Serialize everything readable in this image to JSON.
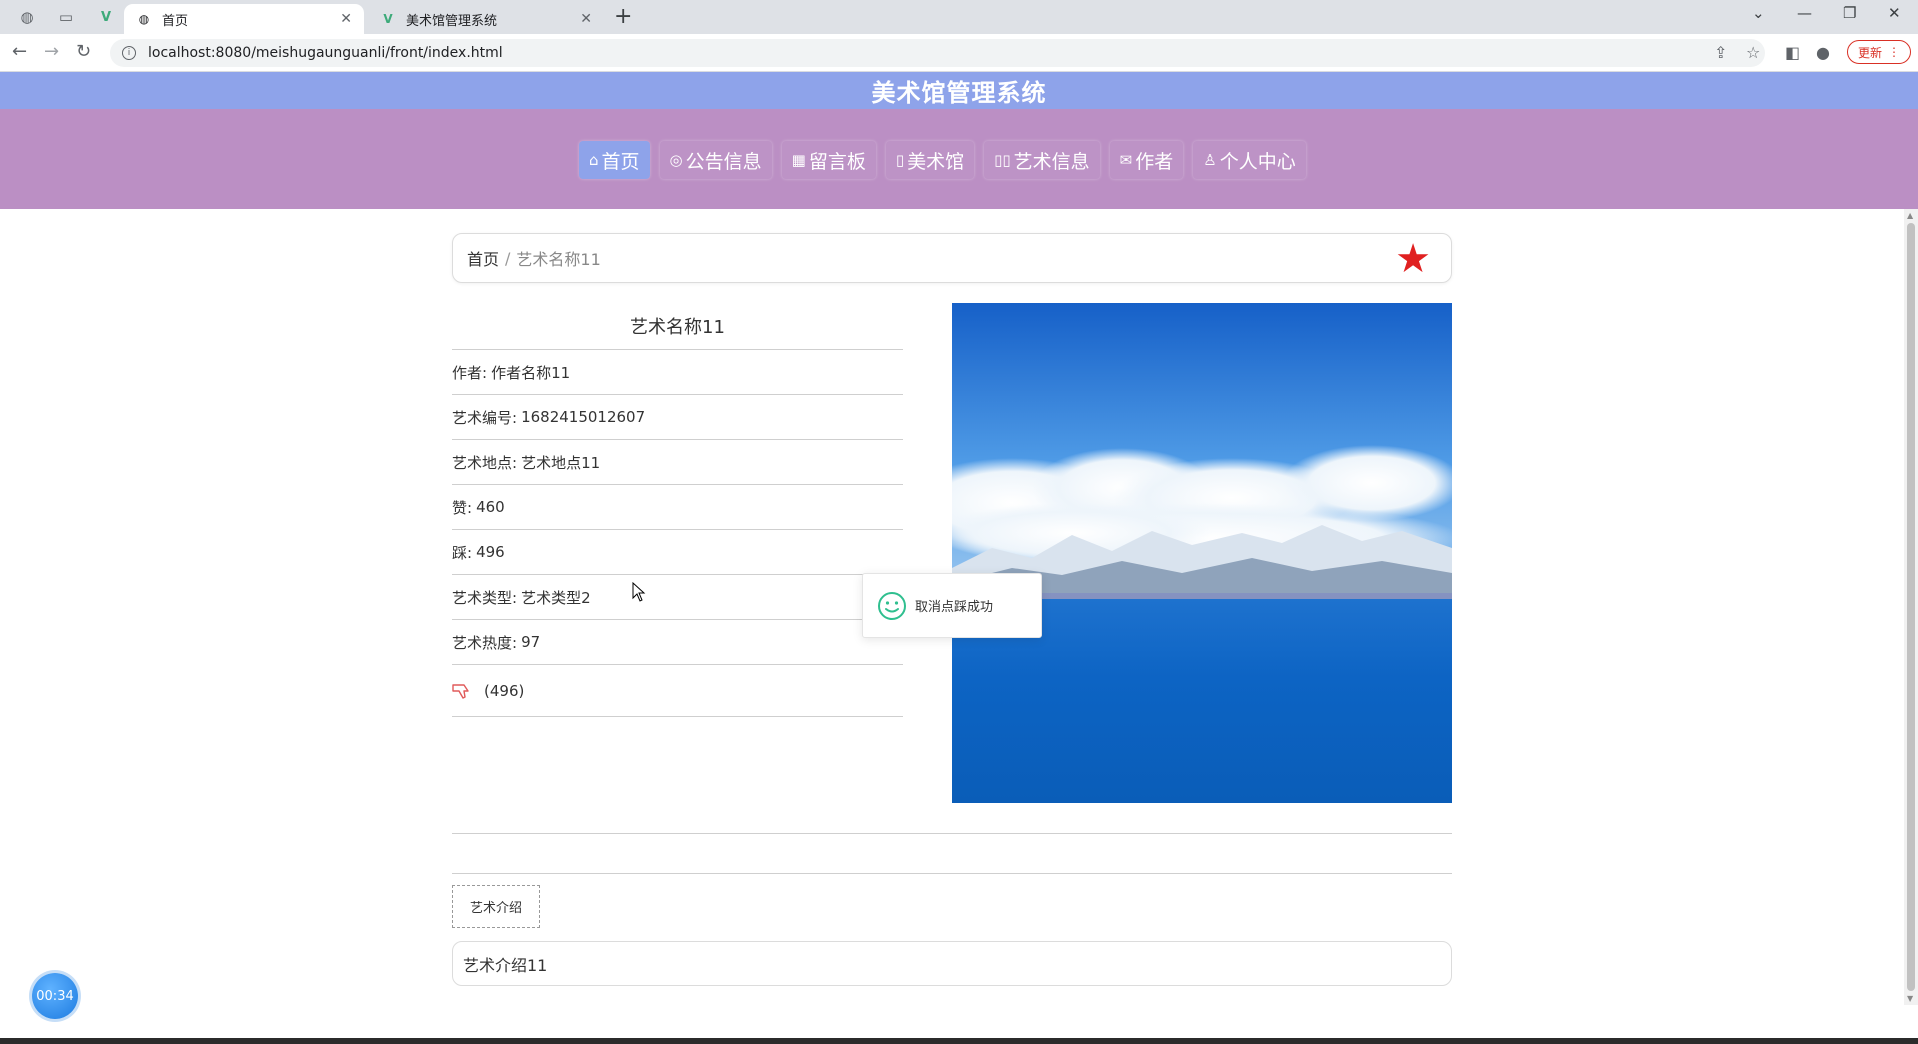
{
  "browser": {
    "tabs": [
      {
        "title": "首页",
        "active": true
      },
      {
        "title": "美术馆管理系统",
        "active": false
      }
    ],
    "url": "localhost:8080/meishugaunguanli/front/index.html",
    "update_label": "更新"
  },
  "site": {
    "title": "美术馆管理系统",
    "menu": [
      {
        "icon": "⌂",
        "label": "首页",
        "active": true
      },
      {
        "icon": "◎",
        "label": "公告信息",
        "active": false
      },
      {
        "icon": "▦",
        "label": "留言板",
        "active": false
      },
      {
        "icon": "▯",
        "label": "美术馆",
        "active": false
      },
      {
        "icon": "▯▯",
        "label": "艺术信息",
        "active": false
      },
      {
        "icon": "✉",
        "label": "作者",
        "active": false
      },
      {
        "icon": "♙",
        "label": "个人中心",
        "active": false
      }
    ]
  },
  "breadcrumb": {
    "home": "首页",
    "separator": "/",
    "current": "艺术名称11"
  },
  "detail": {
    "title": "艺术名称11",
    "rows": [
      {
        "key": "作者:",
        "value": "作者名称11"
      },
      {
        "key": "艺术编号:",
        "value": "1682415012607"
      },
      {
        "key": "艺术地点:",
        "value": "艺术地点11"
      },
      {
        "key": "赞:",
        "value": "460"
      },
      {
        "key": "踩:",
        "value": "496"
      },
      {
        "key": "艺术类型:",
        "value": "艺术类型2"
      },
      {
        "key": "艺术热度:",
        "value": "97"
      }
    ],
    "dislike_count": "(496)"
  },
  "toast": {
    "message": "取消点踩成功"
  },
  "intro": {
    "tab_label": "艺术介绍",
    "content": "艺术介绍11"
  },
  "timer": "00:34",
  "colors": {
    "header": "#8ea3ea",
    "nav": "#bb8fc4",
    "star": "#e02020",
    "toast_icon": "#2fbf8f"
  }
}
